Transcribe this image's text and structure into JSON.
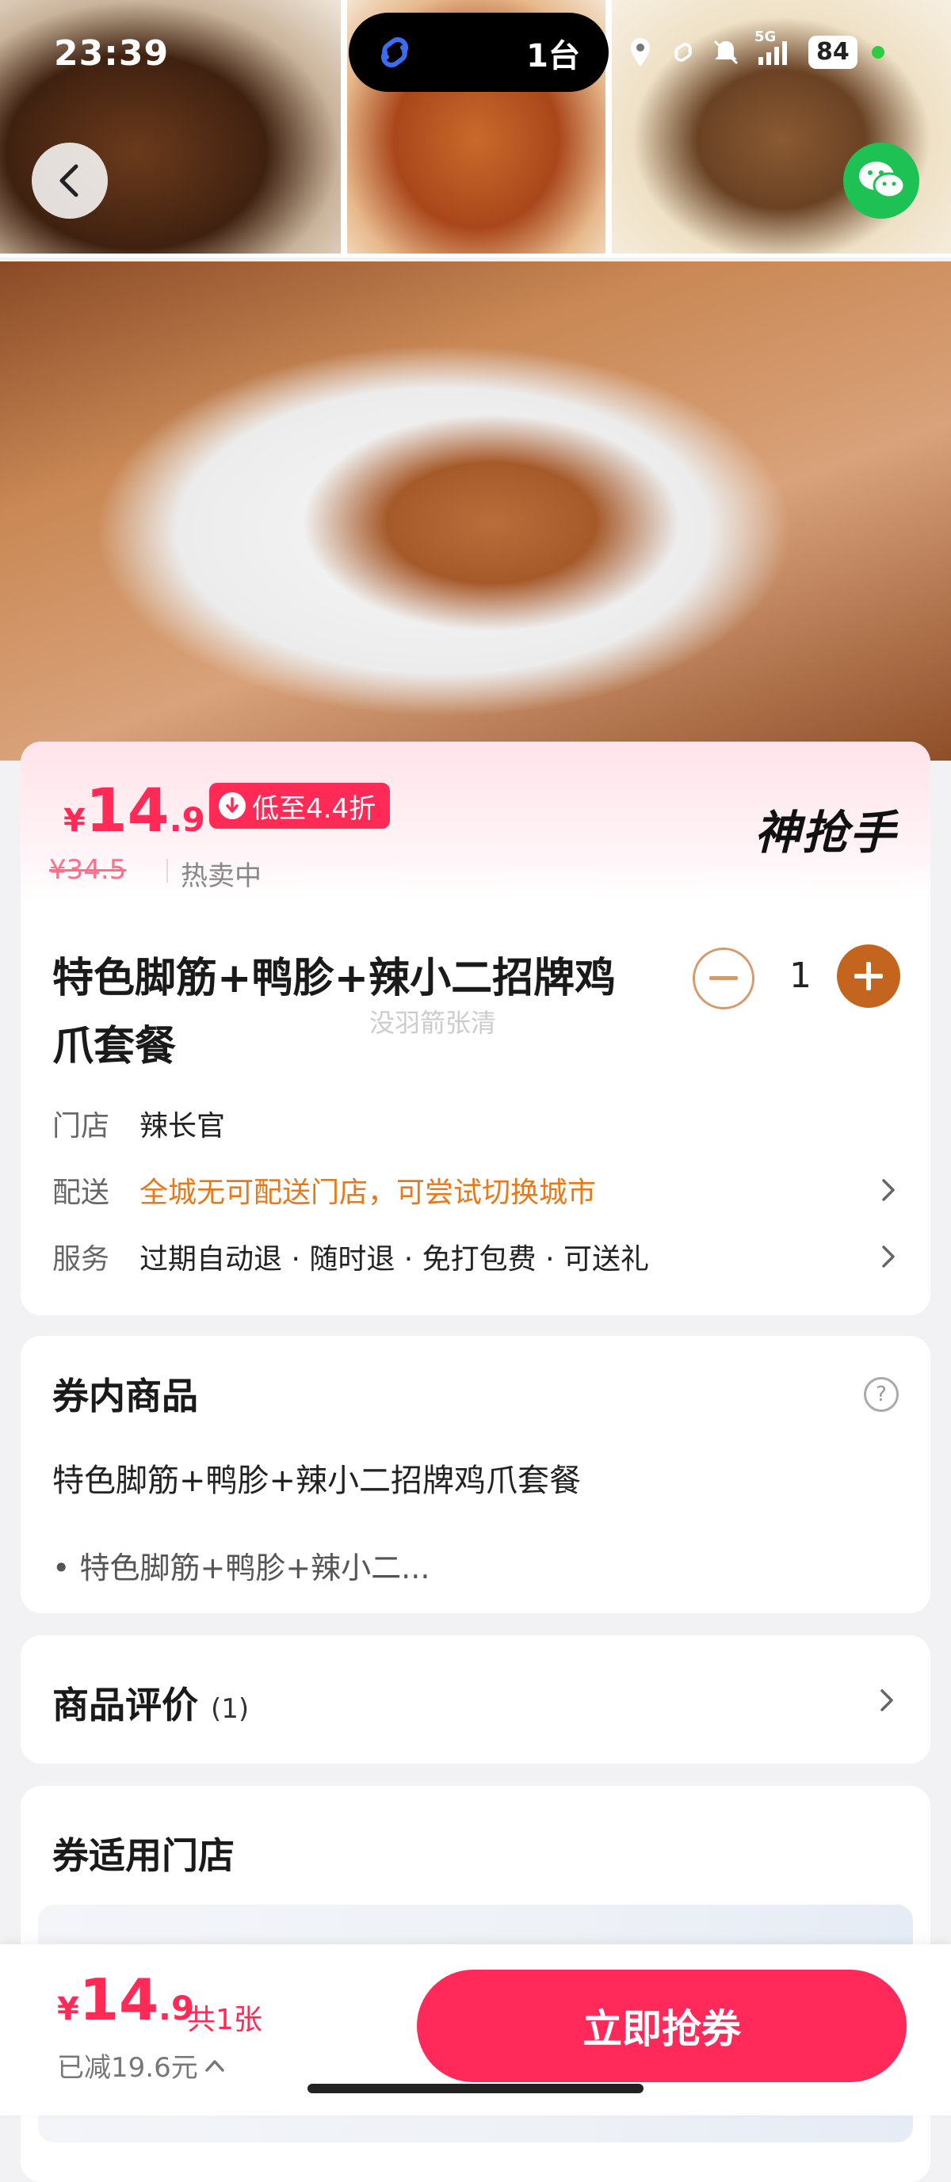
{
  "status_bar": {
    "time": "23:39",
    "island_count": "1台",
    "network": "5G",
    "battery": "84"
  },
  "product": {
    "price_yen": "¥",
    "price_int": "14",
    "price_dec": ".9",
    "discount_label": "低至4.4折",
    "brand": "神抢手",
    "original_price": "¥34.5",
    "sale_status": "热卖中",
    "title": "特色脚筋+鸭胗+辣小二招牌鸡爪套餐",
    "watermark": "没羽箭张清",
    "quantity": "1",
    "store_label": "门店",
    "store_value": "辣长官",
    "delivery_label": "配送",
    "delivery_value": "全城无可配送门店，可尝试切换城市",
    "service_label": "服务",
    "service_value": "过期自动退 · 随时退 · 免打包费 · 可送礼"
  },
  "contents": {
    "title": "券内商品",
    "name": "特色脚筋+鸭胗+辣小二招牌鸡爪套餐",
    "item": "• 特色脚筋+鸭胗+辣小二..."
  },
  "reviews": {
    "title": "商品评价",
    "count": "(1)"
  },
  "stores": {
    "title": "券适用门店"
  },
  "bottom_bar": {
    "price_yen": "¥",
    "price_int": "14",
    "price_dec": ".9",
    "count": "共1张",
    "saved": "已减19.6元",
    "buy_label": "立即抢券"
  },
  "colors": {
    "accent": "#ff2a55",
    "qty_plus": "#c4651f",
    "delivery_warning": "#e8791a",
    "wechat": "#1ec153"
  }
}
